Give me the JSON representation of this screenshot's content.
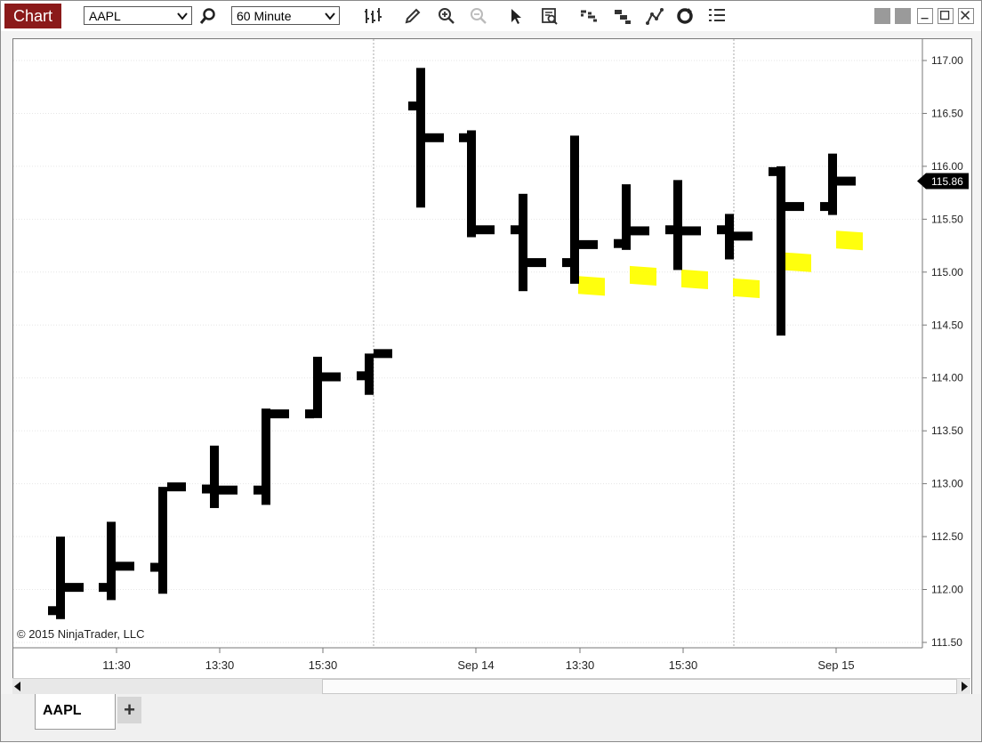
{
  "toolbar": {
    "chart_label": "Chart",
    "instrument": "AAPL",
    "interval": "60 Minute",
    "icons": [
      "bar-type-icon",
      "pencil-icon",
      "zoom-in-icon",
      "zoom-out-icon",
      "pointer-icon",
      "data-box-icon",
      "indicators-icon",
      "strategies-icon",
      "drawing-tools-icon",
      "refresh-icon",
      "properties-icon"
    ]
  },
  "window_controls": [
    "tile-icon",
    "tile-icon",
    "minimize-icon",
    "maximize-icon",
    "close-icon"
  ],
  "chart_data": {
    "type": "ohlc",
    "symbol": "AAPL",
    "interval": "60 Minute",
    "price_axis": {
      "range": [
        111.5,
        117.0
      ],
      "ticks": [
        "117.00",
        "116.50",
        "116.00",
        "115.50",
        "115.00",
        "114.50",
        "114.00",
        "113.50",
        "113.00",
        "112.50",
        "112.00",
        "111.50"
      ]
    },
    "time_axis": {
      "ticks": [
        "11:30",
        "13:30",
        "15:30",
        "Sep 14",
        "13:30",
        "15:30",
        "Sep 15"
      ]
    },
    "last_price": "115.86",
    "bars": [
      {
        "o": 111.8,
        "h": 112.5,
        "l": 111.72,
        "c": 112.02
      },
      {
        "o": 112.02,
        "h": 112.64,
        "l": 111.9,
        "c": 112.22
      },
      {
        "o": 112.21,
        "h": 112.97,
        "l": 111.96,
        "c": 112.97
      },
      {
        "o": 112.95,
        "h": 113.36,
        "l": 112.77,
        "c": 112.94
      },
      {
        "o": 112.94,
        "h": 113.71,
        "l": 112.8,
        "c": 113.66
      },
      {
        "o": 113.66,
        "h": 114.2,
        "l": 113.62,
        "c": 114.01
      },
      {
        "o": 114.02,
        "h": 114.23,
        "l": 113.84,
        "c": 114.23
      },
      {
        "o": 116.57,
        "h": 116.93,
        "l": 115.61,
        "c": 116.27
      },
      {
        "o": 116.27,
        "h": 116.34,
        "l": 115.33,
        "c": 115.4
      },
      {
        "o": 115.4,
        "h": 115.74,
        "l": 114.82,
        "c": 115.09
      },
      {
        "o": 115.09,
        "h": 116.29,
        "l": 114.89,
        "c": 115.26,
        "highlight": true
      },
      {
        "o": 115.27,
        "h": 115.83,
        "l": 115.21,
        "c": 115.39,
        "highlight": true
      },
      {
        "o": 115.4,
        "h": 115.87,
        "l": 115.02,
        "c": 115.39,
        "highlight": true
      },
      {
        "o": 115.4,
        "h": 115.55,
        "l": 115.12,
        "c": 115.34,
        "highlight": true
      },
      {
        "o": 115.95,
        "h": 116.0,
        "l": 114.4,
        "c": 115.62,
        "highlight": true
      },
      {
        "o": 115.62,
        "h": 116.12,
        "l": 115.54,
        "c": 115.86,
        "highlight": true
      }
    ],
    "highlight_color": "#ffff00",
    "bar_color": "#000000"
  },
  "copyright": "© 2015 NinjaTrader, LLC",
  "tabs": [
    {
      "label": "AAPL"
    }
  ],
  "add_tab_label": "+",
  "colors": {
    "brand": "#8b1a1a",
    "grid": "#e4e4e4",
    "background": "#ffffff"
  }
}
